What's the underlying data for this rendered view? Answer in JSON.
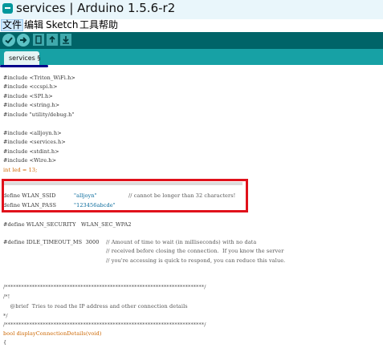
{
  "window": {
    "title": "services | Arduino 1.5.6-r2"
  },
  "menu": {
    "items": [
      "文件",
      "编辑",
      "Sketch",
      "工具",
      "帮助"
    ]
  },
  "toolbar": {
    "icons": [
      "verify-icon",
      "upload-icon",
      "new-icon",
      "open-icon",
      "save-icon"
    ]
  },
  "tabs": {
    "active": "services §"
  },
  "colors": {
    "toolbar_bg": "#006468",
    "tab_strip_bg": "#17a1a5",
    "highlight_border": "#e0111b",
    "keyword": "#cc6600",
    "string": "#006699"
  },
  "code": {
    "includes1": [
      "#include <Triton_WiFi.h>",
      "#include <ccspi.h>",
      "#include <SPI.h>",
      "#include <string.h>",
      "#include \"utility/debug.h\""
    ],
    "includes2": [
      "#include <alljoyn.h>",
      "#include <services.h>",
      "#include <stdint.h>",
      "#include <Wire.h>"
    ],
    "led_line": "int led = 13;",
    "ssid_define": "define WLAN_SSID",
    "ssid_value": "\"alljoyn\"",
    "ssid_comment": "// cannot be longer than 32 characters!",
    "pass_define": "define WLAN_PASS",
    "pass_value": "\"123456abcde\"",
    "security_line": "#define WLAN_SECURITY   WLAN_SEC_WPA2",
    "idle_define": "#define IDLE_TIMEOUT_MS  3000",
    "idle_comment1": "// Amount of time to wait (in milliseconds) with no data",
    "idle_comment2": "// received before closing the connection.  If you know the server",
    "idle_comment3": "// you're accessing is quick to respond, you can reduce this value.",
    "rule1": "/**************************************************************************/",
    "doc_open": "/*!",
    "doc_brief": "    @brief  Tries to read the IP address and other connection details",
    "doc_close": "*/",
    "rule2": "/**************************************************************************/",
    "func_sig": "bool displayConnectionDetails(void)",
    "brace": "{"
  }
}
